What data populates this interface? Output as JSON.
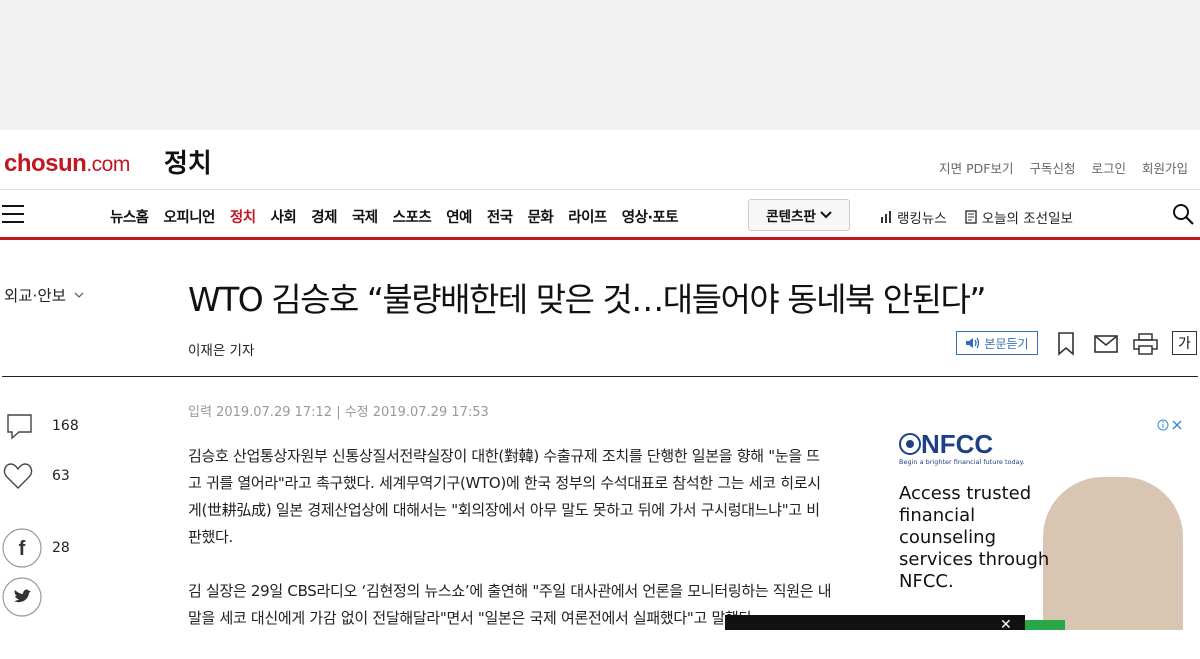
{
  "masthead": {
    "logo_main": "chosun",
    "logo_domain": ".com",
    "section": "정치",
    "util_links": [
      "지면 PDF보기",
      "구독신청",
      "로그인",
      "회원가입"
    ]
  },
  "gnb": {
    "items": [
      "뉴스홈",
      "오피니언",
      "정치",
      "사회",
      "경제",
      "국제",
      "스포츠",
      "연예",
      "전국",
      "문화",
      "라이프",
      "영상·포토"
    ],
    "active_index": 2,
    "content_button": "콘텐츠판",
    "ranking": "랭킹뉴스",
    "today_paper": "오늘의 조선일보"
  },
  "article": {
    "category": "외교·안보",
    "headline": "WTO 김승호 “불량배한테 맞은 것…대들어야 동네북 안된다”",
    "byline": "이재은 기자",
    "tts_label": "본문듣기",
    "font_size_label": "가",
    "dateline": "입력 2019.07.29 17:12 | 수정 2019.07.29 17:53",
    "paragraphs": [
      "김승호 산업통상자원부 신통상질서전략실장이 대한(對韓) 수출규제 조치를 단행한 일본을 향해 \"눈을 뜨고 귀를 열어라\"라고 촉구했다. 세계무역기구(WTO)에 한국 정부의 수석대표로 참석한 그는 세코 히로시게(世耕弘成) 일본 경제산업상에 대해서는 \"회의장에서 아무 말도 못하고 뒤에 가서 구시렁대느냐\"고 비판했다.",
      "김 실장은 29일 CBS라디오 ‘김현정의 뉴스쇼’에 출연해 \"주일 대사관에서 언론을 모니터링하는 직원은 내 말을 세코 대신에게 가감 없이 전달해달라\"면서 \"일본은 국제 여론전에서 실패했다\"고 말했다."
    ]
  },
  "social": {
    "comments": "168",
    "likes": "63",
    "facebook": "28"
  },
  "ad": {
    "brand": "NFCC",
    "tagline": "Begin a brighter financial future today.",
    "copy": "Access trusted financial counseling services through NFCC."
  },
  "colors": {
    "brand_red": "#c3171f",
    "tts_blue": "#2f6fb5",
    "nfcc_blue": "#1f3f86"
  }
}
